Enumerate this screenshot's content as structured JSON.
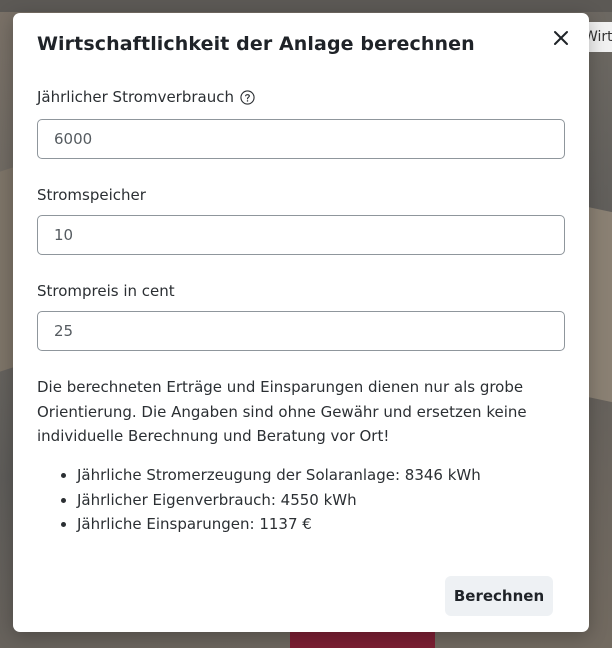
{
  "background": {
    "behind_tab_text": "Wirts"
  },
  "dialog": {
    "title": "Wirtschaftlichkeit der Anlage berechnen",
    "close_icon": "close-icon",
    "fields": {
      "consumption": {
        "label": "Jährlicher Stromverbrauch",
        "help_icon": "question-circle-icon",
        "value": "6000"
      },
      "storage": {
        "label": "Stromspeicher",
        "value": "10"
      },
      "price": {
        "label": "Strompreis in cent",
        "value": "25"
      }
    },
    "disclaimer": "Die berechneten Erträge und Einsparungen dienen nur als grobe Orientierung. Die Angaben sind ohne Gewähr und ersetzen keine individuelle Berechnung und Beratung vor Ort!",
    "results": [
      "Jährliche Stromerzeugung der Solaranlage: 8346 kWh",
      "Jährlicher Eigenverbrauch: 4550 kWh",
      "Jährliche Einsparungen: 1137 €"
    ],
    "submit_label": "Berechnen"
  },
  "colors": {
    "primary_text": "#1f2328",
    "button_bg": "#eef1f4",
    "input_border": "#8f969c",
    "overlay": "#6f6d69",
    "accent_roof": "#7b1f33"
  }
}
